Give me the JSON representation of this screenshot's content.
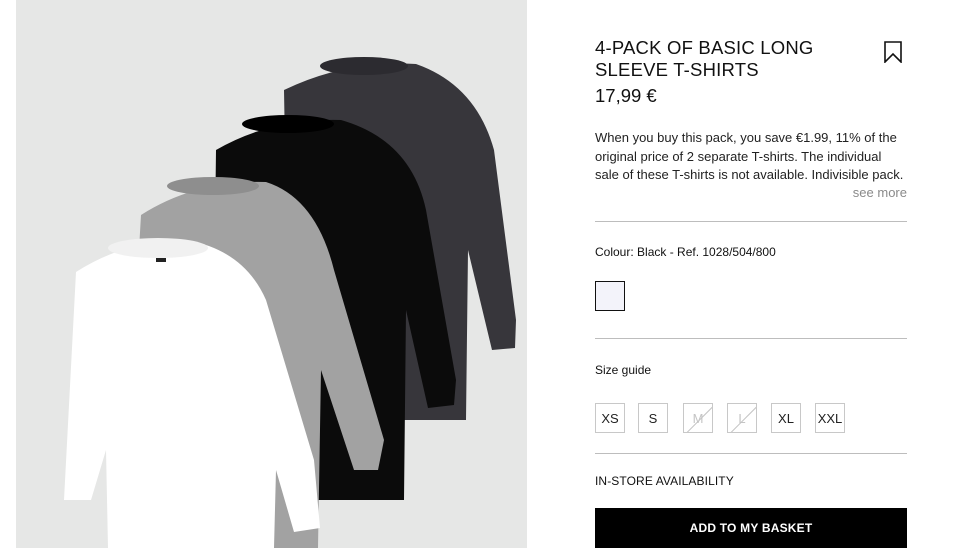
{
  "product": {
    "title": "4-PACK OF BASIC LONG SLEEVE T-SHIRTS",
    "price": "17,99 €",
    "description": "When you buy this pack, you save €1.99, 11% of the original price of 2 separate T-shirts. The individual sale of these T-shirts is not available. Indivisible pack.",
    "see_more_label": "see more",
    "bookmark_icon": "bookmark-icon",
    "image_description_colors": {
      "background": "#e6e7e6",
      "shirts": [
        "#37363b",
        "#0b0b0b",
        "#a2a2a2",
        "#ffffff"
      ]
    }
  },
  "colour": {
    "line": "Colour: Black - Ref. 1028/504/800",
    "swatch_color": "#f3f3fa"
  },
  "sizes": {
    "guide_label": "Size guide",
    "options": [
      {
        "label": "XS",
        "available": true
      },
      {
        "label": "S",
        "available": true
      },
      {
        "label": "M",
        "available": false
      },
      {
        "label": "L",
        "available": false
      },
      {
        "label": "XL",
        "available": true
      },
      {
        "label": "XXL",
        "available": true
      }
    ]
  },
  "availability_label": "IN-STORE AVAILABILITY",
  "basket_button_label": "ADD TO MY BASKET"
}
